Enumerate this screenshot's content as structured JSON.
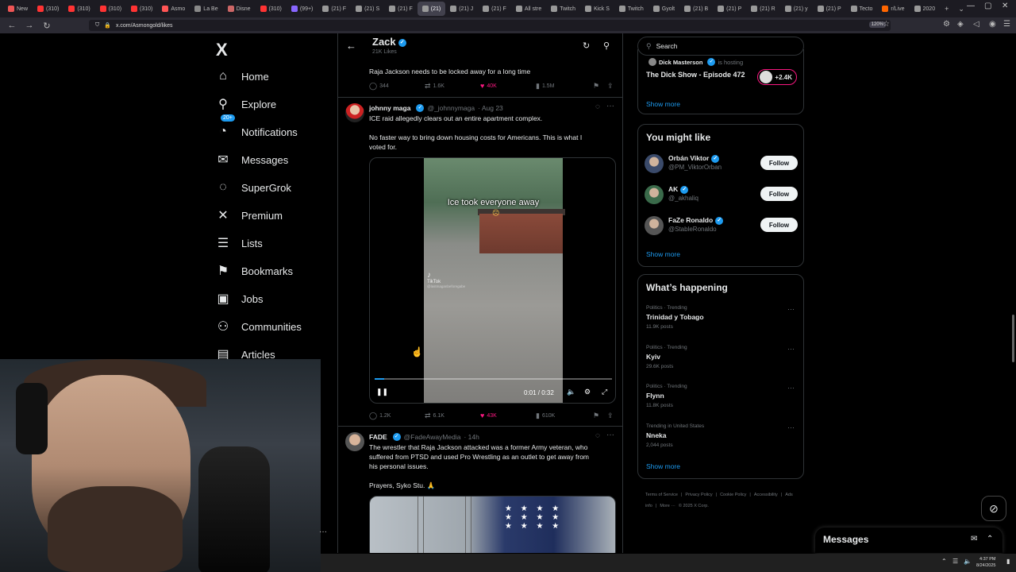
{
  "browser": {
    "tabs": [
      {
        "label": "New",
        "color": "#e55"
      },
      {
        "label": "(310)",
        "color": "#f33"
      },
      {
        "label": "(310)",
        "color": "#f33"
      },
      {
        "label": "(310)",
        "color": "#f33"
      },
      {
        "label": "(310)",
        "color": "#f33"
      },
      {
        "label": "Asmo",
        "color": "#f55"
      },
      {
        "label": "La Be",
        "color": "#888"
      },
      {
        "label": "Disne",
        "color": "#c66"
      },
      {
        "label": "(310)",
        "color": "#f33"
      },
      {
        "label": "(99+)",
        "color": "#86f"
      },
      {
        "label": "(21) F",
        "color": "#999"
      },
      {
        "label": "(21) S",
        "color": "#999"
      },
      {
        "label": "(21) F",
        "color": "#999"
      },
      {
        "label": "(21)",
        "color": "#999",
        "active": true
      },
      {
        "label": "(21) J",
        "color": "#999"
      },
      {
        "label": "(21) F",
        "color": "#999"
      },
      {
        "label": "All stre",
        "color": "#999"
      },
      {
        "label": "Twitch",
        "color": "#999"
      },
      {
        "label": "Kick S",
        "color": "#999"
      },
      {
        "label": "Twitch",
        "color": "#999"
      },
      {
        "label": "Gyolt",
        "color": "#999"
      },
      {
        "label": "(21) B",
        "color": "#999"
      },
      {
        "label": "(21) P",
        "color": "#999"
      },
      {
        "label": "(21) R",
        "color": "#999"
      },
      {
        "label": "(21) y",
        "color": "#999"
      },
      {
        "label": "(21) P",
        "color": "#999"
      },
      {
        "label": "Tecto",
        "color": "#999"
      },
      {
        "label": "r/Live",
        "color": "#f60"
      },
      {
        "label": "2020",
        "color": "#999"
      }
    ],
    "url": "x.com/Asmongold/likes",
    "zoom": "120%"
  },
  "nav": {
    "logo": "X",
    "notifications_badge": "20+",
    "items": [
      {
        "label": "Home",
        "icon": "⌂"
      },
      {
        "label": "Explore",
        "icon": "⚲"
      },
      {
        "label": "Notifications",
        "icon": "◔"
      },
      {
        "label": "Messages",
        "icon": "✉"
      },
      {
        "label": "SuperGrok",
        "icon": "◌"
      },
      {
        "label": "Premium",
        "icon": "✕"
      },
      {
        "label": "Lists",
        "icon": "☰"
      },
      {
        "label": "Bookmarks",
        "icon": "⚑"
      },
      {
        "label": "Jobs",
        "icon": "▣"
      },
      {
        "label": "Communities",
        "icon": "⚇"
      },
      {
        "label": "Articles",
        "icon": "▤"
      }
    ]
  },
  "header": {
    "name": "Zack",
    "sub": "21K Likes"
  },
  "tweet1": {
    "text": "Raja Jackson needs to be locked away for a long time",
    "replies": "344",
    "reposts": "1.6K",
    "likes": "40K",
    "views": "1.5M"
  },
  "tweet2": {
    "name": "johnny maga",
    "handle": "@_johnnymaga",
    "time": "· Aug 23",
    "text1": "ICE raid allegedly clears out an entire apartment complex.",
    "text2": "No faster way to bring down housing costs for Americans. This is what I",
    "text3": "voted for.",
    "video_caption": "Ice took everyone away",
    "video_emoji": "☹",
    "video_watermark": "TikTok",
    "video_watermark_handle": "@lastmaganbeforegabe",
    "video_time": "0:01 / 0:32",
    "replies": "1.2K",
    "reposts": "6.1K",
    "likes": "43K",
    "views": "610K",
    "progress": 0.04
  },
  "tweet3": {
    "name": "FADE",
    "handle": "@FadeAwayMedia",
    "time": "· 14h",
    "text1": "The wrestler that Raja Jackson attacked was a former Army veteran, who",
    "text2": "suffered from PTSD and used Pro Wrestling as an outlet to get away from",
    "text3": "his personal issues.",
    "text4": "Prayers, Syko Stu. 🙏"
  },
  "right": {
    "search_placeholder": "Search",
    "space": {
      "host": "Dick Masterson",
      "hosting": "is hosting",
      "title": "The Dick Show - Episode 472",
      "listeners": "+2.4K",
      "show_more": "Show more"
    },
    "might_like": {
      "title": "You might like",
      "follow_label": "Follow",
      "show_more": "Show more",
      "users": [
        {
          "name": "Orbán Viktor",
          "handle": "@PM_ViktorOrban",
          "color": "#3a4a6a"
        },
        {
          "name": "AK",
          "handle": "@_akhaliq",
          "color": "#3a6a4a"
        },
        {
          "name": "FaZe Ronaldo",
          "handle": "@StableRonaldo",
          "color": "#555"
        }
      ]
    },
    "happening": {
      "title": "What’s happening",
      "show_more": "Show more",
      "trends": [
        {
          "category": "Politics · Trending",
          "name": "Trinidad y Tobago",
          "posts": "11.9K posts"
        },
        {
          "category": "Politics · Trending",
          "name": "Kyiv",
          "posts": "29.6K posts"
        },
        {
          "category": "Politics · Trending",
          "name": "Flynn",
          "posts": "11.8K posts"
        },
        {
          "category": "Trending in United States",
          "name": "Nneka",
          "posts": "2,044 posts"
        }
      ]
    },
    "footer": [
      "Terms of Service",
      "|",
      "Privacy Policy",
      "|",
      "Cookie Policy",
      "|",
      "Accessibility",
      "|",
      "Ads info",
      "|",
      "More ···",
      "© 2025 X Corp."
    ]
  },
  "messages": {
    "title": "Messages"
  },
  "taskbar": {
    "time": "4:37 PM",
    "date": "8/24/2025"
  }
}
